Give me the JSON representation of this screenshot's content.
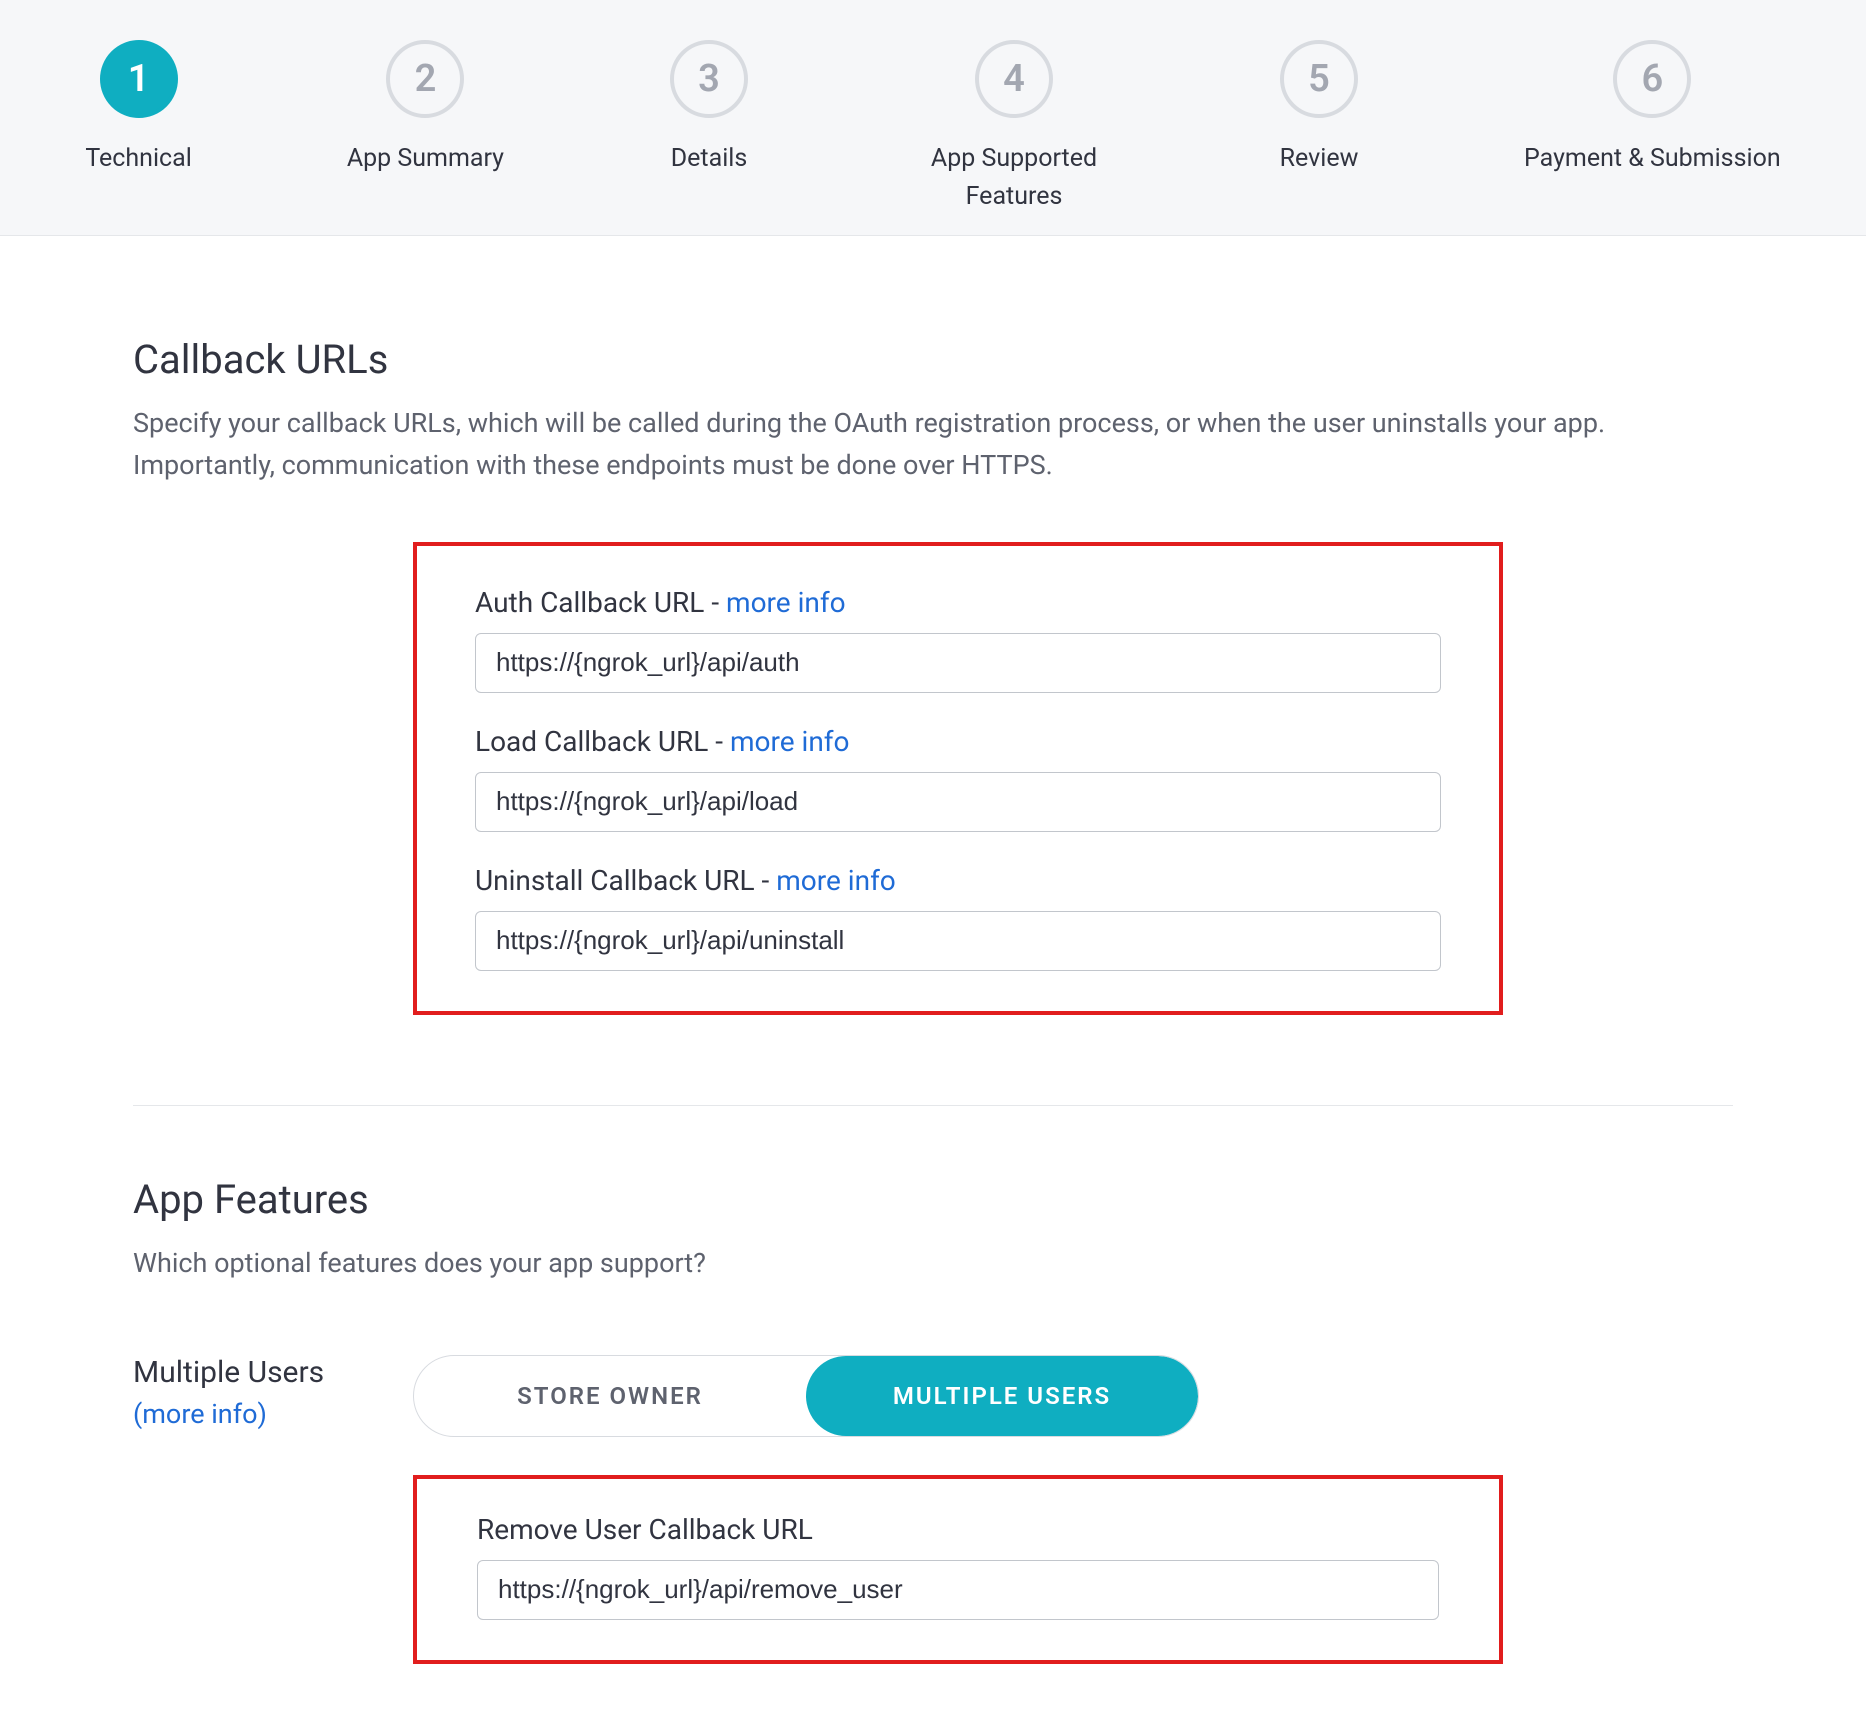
{
  "stepper": {
    "steps": [
      {
        "num": "1",
        "label": "Technical",
        "active": true
      },
      {
        "num": "2",
        "label": "App Summary",
        "active": false
      },
      {
        "num": "3",
        "label": "Details",
        "active": false
      },
      {
        "num": "4",
        "label": "App Supported Features",
        "active": false
      },
      {
        "num": "5",
        "label": "Review",
        "active": false
      },
      {
        "num": "6",
        "label": "Payment & Submission",
        "active": false
      }
    ]
  },
  "callback_section": {
    "title": "Callback URLs",
    "description": "Specify your callback URLs, which will be called during the OAuth registration process, or when the user uninstalls your app. Importantly, communication with these endpoints must be done over HTTPS.",
    "fields": [
      {
        "label": "Auth Callback URL",
        "sep": " - ",
        "more": "more info",
        "value": "https://{ngrok_url}/api/auth"
      },
      {
        "label": "Load Callback URL",
        "sep": " - ",
        "more": "more info",
        "value": "https://{ngrok_url}/api/load"
      },
      {
        "label": "Uninstall Callback URL",
        "sep": " - ",
        "more": "more info",
        "value": "https://{ngrok_url}/api/uninstall"
      }
    ]
  },
  "features_section": {
    "title": "App Features",
    "description": "Which optional features does your app support?",
    "multiple_users": {
      "label": "Multiple Users",
      "more": "(more info)",
      "options": [
        {
          "text": "STORE OWNER",
          "active": false
        },
        {
          "text": "MULTIPLE USERS",
          "active": true
        }
      ],
      "remove_user": {
        "label": "Remove User Callback URL",
        "value": "https://{ngrok_url}/api/remove_user"
      }
    }
  }
}
